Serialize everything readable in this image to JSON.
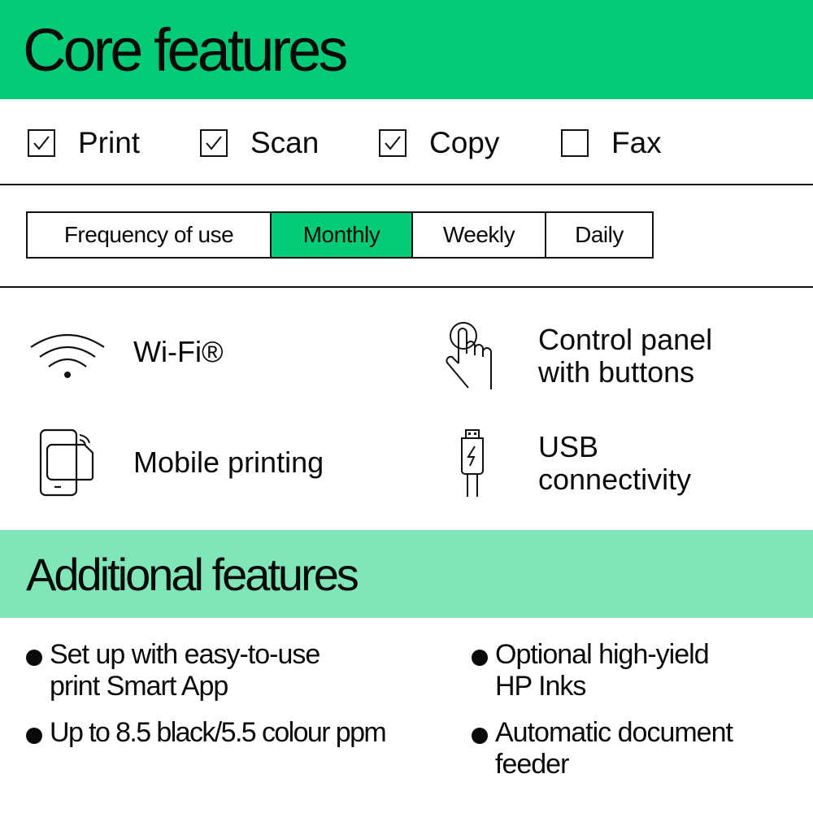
{
  "core": {
    "title": "Core features",
    "accent_color": "#04cc76",
    "functions": [
      {
        "label": "Print",
        "checked": true
      },
      {
        "label": "Scan",
        "checked": true
      },
      {
        "label": "Copy",
        "checked": true
      },
      {
        "label": "Fax",
        "checked": false
      }
    ],
    "frequency": {
      "label": "Frequency of use",
      "options": [
        "Monthly",
        "Weekly",
        "Daily"
      ],
      "selected": "Monthly"
    },
    "features": [
      {
        "icon": "wifi-icon",
        "text": "Wi-Fi®"
      },
      {
        "icon": "touch-hand-icon",
        "text_line1": "Control panel",
        "text_line2": "with buttons"
      },
      {
        "icon": "mobile-print-icon",
        "text": "Mobile printing"
      },
      {
        "icon": "usb-icon",
        "text_line1": "USB",
        "text_line2": "connectivity"
      }
    ]
  },
  "additional": {
    "title": "Additional features",
    "accent_color": "#80e6b8",
    "bullets": [
      {
        "line1": "Set up with easy-to-use",
        "line2": "print Smart App"
      },
      {
        "line1": "Optional high-yield",
        "line2": "HP Inks"
      },
      {
        "line1": "Up to 8.5 black/5.5 colour ppm",
        "line2": ""
      },
      {
        "line1": "Automatic document",
        "line2": "feeder"
      }
    ]
  }
}
